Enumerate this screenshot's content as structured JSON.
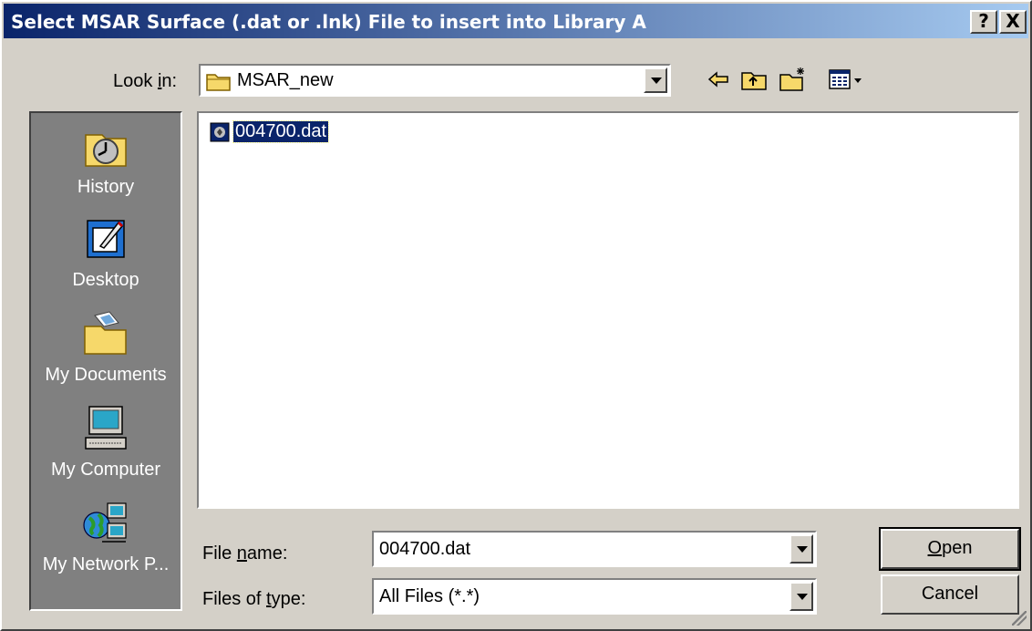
{
  "window": {
    "title": "Select MSAR Surface (.dat or .lnk) File to insert into Library A",
    "help_button": "?",
    "close_button": "X"
  },
  "look_in": {
    "label": "Look in:",
    "value": "MSAR_new",
    "icon": "folder-icon"
  },
  "toolbar": {
    "icons": [
      "back-arrow-icon",
      "up-folder-icon",
      "new-folder-icon",
      "view-menu-icon"
    ]
  },
  "places": [
    {
      "label": "History",
      "icon": "history-icon"
    },
    {
      "label": "Desktop",
      "icon": "desktop-icon"
    },
    {
      "label": "My Documents",
      "icon": "my-documents-icon"
    },
    {
      "label": "My Computer",
      "icon": "my-computer-icon"
    },
    {
      "label": "My Network P...",
      "icon": "network-icon"
    }
  ],
  "files": [
    {
      "name": "004700.dat",
      "icon": "dat-file-icon",
      "selected": true
    }
  ],
  "file_name": {
    "label": "File name:",
    "value": "004700.dat"
  },
  "file_type": {
    "label": "Files of type:",
    "value": "All Files (*.*)"
  },
  "buttons": {
    "open": "Open",
    "cancel": "Cancel"
  },
  "colors": {
    "titlebar_start": "#0a246a",
    "titlebar_end": "#a6caf0",
    "dialog_face": "#d4d0c8",
    "places_bar": "#808080",
    "selection": "#0a246a"
  }
}
